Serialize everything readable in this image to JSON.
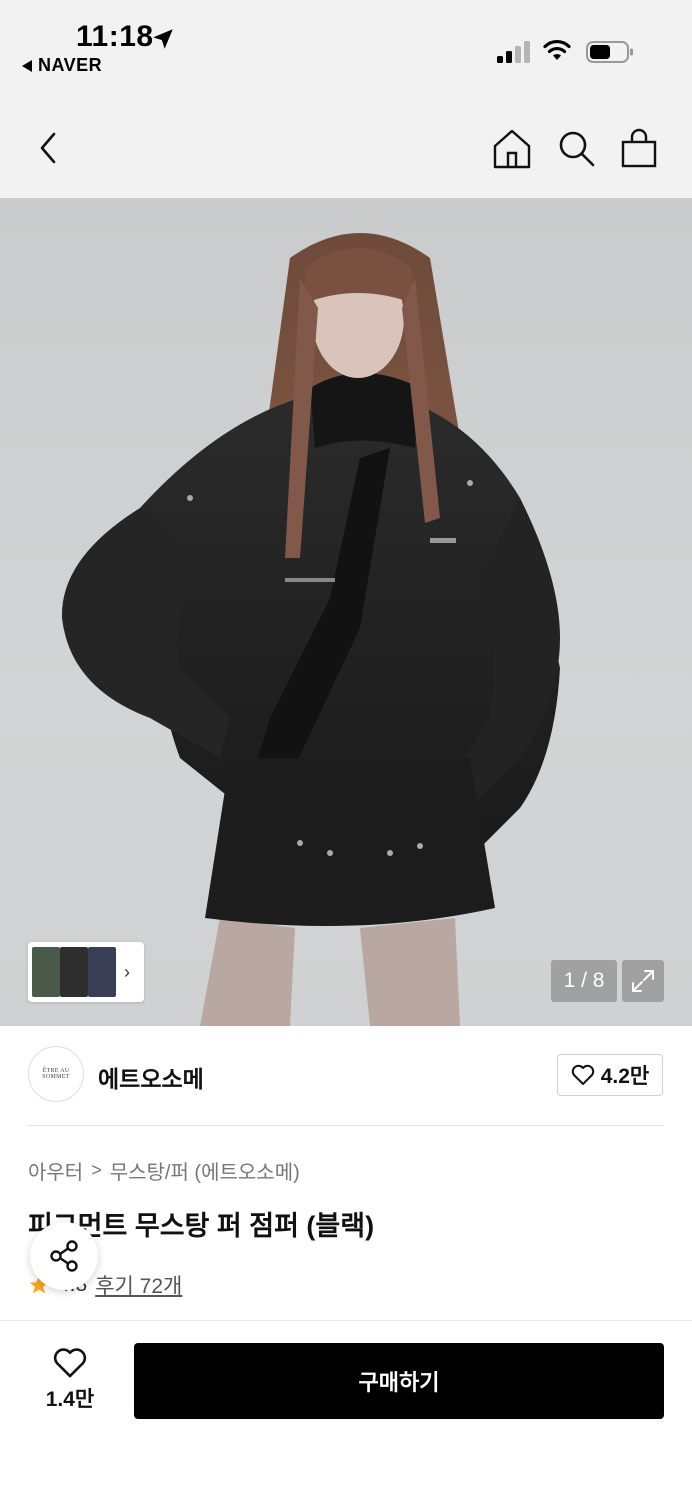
{
  "status_bar": {
    "time": "11:18",
    "back_app": "NAVER",
    "icons": [
      "location-arrow-icon",
      "signal-icon",
      "wifi-icon",
      "battery-icon"
    ]
  },
  "nav": {
    "icons": [
      "chevron-left-icon",
      "home-icon",
      "search-icon",
      "shopping-bag-icon"
    ]
  },
  "hero": {
    "page_counter": "1 / 8",
    "thumb_chevron": "›",
    "icons": [
      "expand-icon"
    ]
  },
  "brand": {
    "logo_text": "ÊTRE AU SOMMET",
    "name": "에트오소메",
    "like_count": "4.2만",
    "icons": [
      "heart-outline-icon"
    ]
  },
  "product": {
    "breadcrumb": [
      "아우터",
      "무스탕/퍼 (에트오소메)"
    ],
    "breadcrumb_separator": ">",
    "title": "피그먼트 무스탕 퍼 점퍼 (블랙)",
    "rating": "4.8",
    "reviews": "후기 72개",
    "icons": [
      "star-icon",
      "share-icon"
    ]
  },
  "bottom_bar": {
    "wish_count": "1.4만",
    "buy_label": "구매하기",
    "icons": [
      "heart-outline-icon"
    ]
  },
  "colors": {
    "header_bg": "#f2f2f2",
    "buy_button": "#000000",
    "star": "#f5a623"
  }
}
